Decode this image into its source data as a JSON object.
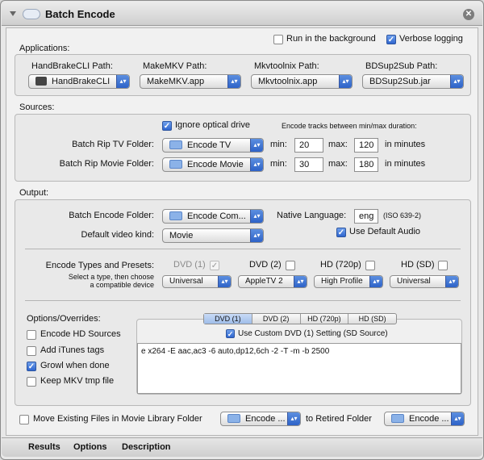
{
  "window": {
    "title": "Batch Encode",
    "close_icon": "close-icon"
  },
  "top_options": {
    "run_background": "Run in the background",
    "run_background_checked": false,
    "verbose": "Verbose logging",
    "verbose_checked": true
  },
  "applications": {
    "label": "Applications:",
    "items": [
      {
        "label": "HandBrakeCLI Path:",
        "value": "HandBrakeCLI"
      },
      {
        "label": "MakeMKV Path:",
        "value": "MakeMKV.app"
      },
      {
        "label": "Mkvtoolnix Path:",
        "value": "Mkvtoolnix.app"
      },
      {
        "label": "BDSup2Sub Path:",
        "value": "BDSup2Sub.jar"
      }
    ]
  },
  "sources": {
    "label": "Sources:",
    "ignore_optical": "Ignore optical drive",
    "ignore_optical_checked": true,
    "duration_note": "Encode tracks between min/max duration:",
    "tv_label": "Batch Rip TV Folder:",
    "tv_folder": "Encode TV",
    "tv_min": "20",
    "tv_max": "120",
    "movie_label": "Batch Rip Movie Folder:",
    "movie_folder": "Encode Movie",
    "movie_min": "30",
    "movie_max": "180",
    "min_label": "min:",
    "max_label": "max:",
    "in_minutes": "in minutes"
  },
  "output": {
    "label": "Output:",
    "encode_folder_label": "Batch Encode Folder:",
    "encode_folder": "Encode Com...",
    "native_lang_label": "Native Language:",
    "native_lang": "eng",
    "iso_note": "(ISO 639-2)",
    "video_kind_label": "Default video kind:",
    "video_kind": "Movie",
    "use_default_audio": "Use Default Audio",
    "use_default_audio_checked": true,
    "types_label": "Encode Types and Presets:",
    "select_note_1": "Select a type, then choose",
    "select_note_2": "a compatible device",
    "types": [
      {
        "label": "DVD (1)",
        "checked": true,
        "disabled": true,
        "preset": "Universal"
      },
      {
        "label": "DVD (2)",
        "checked": false,
        "disabled": false,
        "preset": "AppleTV 2"
      },
      {
        "label": "HD (720p)",
        "checked": false,
        "disabled": false,
        "preset": "High Profile"
      },
      {
        "label": "HD (SD)",
        "checked": false,
        "disabled": false,
        "preset": "Universal"
      }
    ],
    "overrides_label": "Options/Overrides:",
    "overrides": [
      {
        "label": "Encode HD Sources",
        "checked": false
      },
      {
        "label": "Add iTunes tags",
        "checked": false
      },
      {
        "label": "Growl when done",
        "checked": true
      },
      {
        "label": "Keep MKV tmp file",
        "checked": false
      }
    ],
    "tabs": [
      "DVD (1)",
      "DVD (2)",
      "HD (720p)",
      "HD (SD)"
    ],
    "use_custom": "Use Custom DVD (1) Setting (SD Source)",
    "use_custom_checked": true,
    "custom_args": "e x264 -E aac,ac3 -6 auto,dp12,6ch -2 -T -m -b 2500"
  },
  "move": {
    "label": "Move Existing Files in Movie Library Folder",
    "checked": false,
    "from_folder": "Encode ...",
    "to_label": "to Retired Folder",
    "to_folder": "Encode ..."
  },
  "bottom_tabs": [
    "Results",
    "Options",
    "Description"
  ]
}
